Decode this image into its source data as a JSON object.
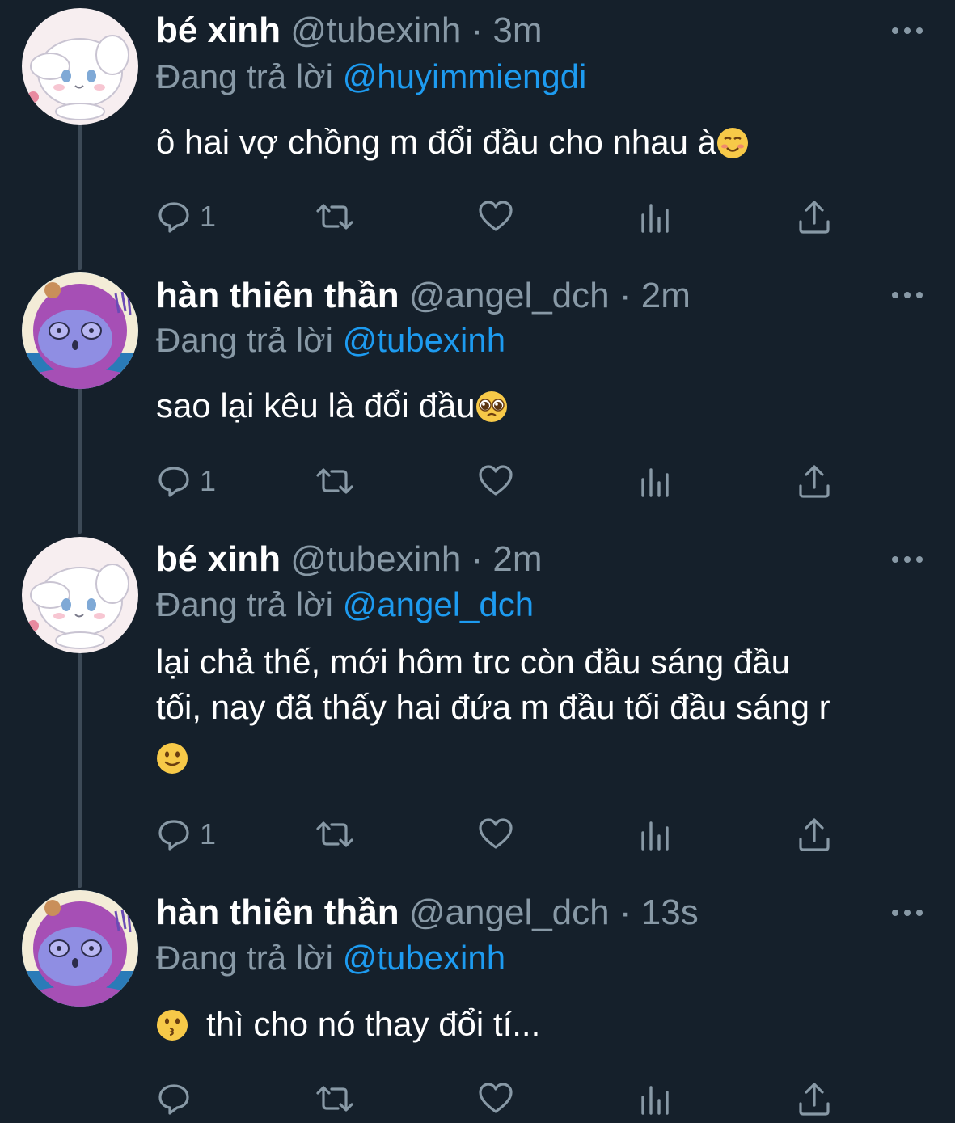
{
  "colors": {
    "background": "#15202b",
    "text_primary": "#ffffff",
    "text_secondary": "#8899a6",
    "accent_mention": "#1d9bf0",
    "thread_line": "#3d4a57"
  },
  "tweets": [
    {
      "name": "bé xinh",
      "handle": "@tubexinh",
      "dot": "·",
      "time": "3m",
      "reply_prefix": "Đang trả lời",
      "reply_to": "@huyimmiengdi",
      "text": "ô hai vợ chồng m đổi đầu cho nhau à",
      "emoji": "smiling-face-emoji",
      "reply_count": "1",
      "avatar": "white-puppy-character-avatar"
    },
    {
      "name": "hàn thiên thần",
      "handle": "@angel_dch",
      "dot": "·",
      "time": "2m",
      "reply_prefix": "Đang trả lời",
      "reply_to": "@tubexinh",
      "text": "sao lại kêu là đổi đầu",
      "emoji": "pleading-face-emoji",
      "reply_count": "1",
      "avatar": "purple-hood-character-avatar"
    },
    {
      "name": "bé xinh",
      "handle": "@tubexinh",
      "dot": "·",
      "time": "2m",
      "reply_prefix": "Đang trả lời",
      "reply_to": "@angel_dch",
      "text_line1": "lại chả thế, mới hôm trc còn đầu sáng đầu",
      "text_line2": "tối, nay đã thấy hai đứa m đầu tối đầu sáng r",
      "emoji": "slightly-smiling-face-emoji",
      "reply_count": "1",
      "avatar": "white-puppy-character-avatar"
    },
    {
      "name": "hàn thiên thần",
      "handle": "@angel_dch",
      "dot": "·",
      "time": "13s",
      "reply_prefix": "Đang trả lời",
      "reply_to": "@tubexinh",
      "text": "thì cho nó thay đổi tí...",
      "emoji": "kissing-face-emoji",
      "reply_count": "",
      "avatar": "purple-hood-character-avatar"
    }
  ],
  "icons": {
    "reply": "reply-icon",
    "retweet": "retweet-icon",
    "like": "heart-icon",
    "views": "views-icon",
    "share": "share-icon",
    "more": "more-icon"
  }
}
